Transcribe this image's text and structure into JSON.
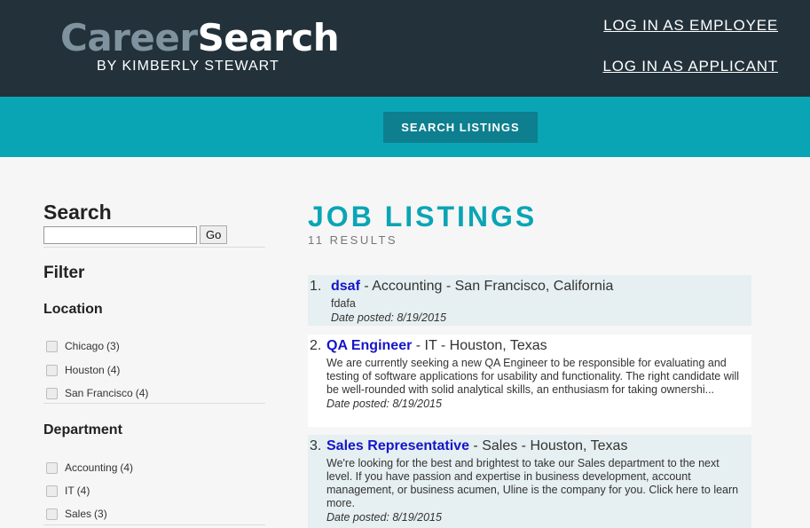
{
  "header": {
    "logo_part1": "Career",
    "logo_part2": "Search",
    "byline": "BY KIMBERLY STEWART",
    "link_employee": "LOG IN AS EMPLOYEE",
    "link_applicant": "LOG IN AS APPLICANT"
  },
  "nav": {
    "search_listings": "SEARCH LISTINGS"
  },
  "sidebar": {
    "search_heading": "Search",
    "search_value": "",
    "go_label": "Go",
    "filter_heading": "Filter",
    "location_heading": "Location",
    "locations": [
      {
        "label": "Chicago",
        "count": "(3)"
      },
      {
        "label": "Houston",
        "count": "(4)"
      },
      {
        "label": "San Francisco",
        "count": "(4)"
      }
    ],
    "department_heading": "Department",
    "departments": [
      {
        "label": "Accounting",
        "count": "(4)"
      },
      {
        "label": "IT",
        "count": "(4)"
      },
      {
        "label": "Sales",
        "count": "(3)"
      }
    ]
  },
  "main": {
    "title": "JOB LISTINGS",
    "results": "11 RESULTS",
    "listings": [
      {
        "num": "1.",
        "title": "dsaf",
        "meta": " - Accounting - San Francisco, California",
        "description": "fdafa",
        "date": "Date posted: 8/19/2015"
      },
      {
        "num": "2.",
        "title": "QA Engineer",
        "meta": " - IT - Houston, Texas",
        "description": "We are currently seeking a new QA Engineer to be responsible for evaluating and testing of software applications for usability and functionality. The right candidate will be well-rounded with solid analytical skills, an enthusiasm for taking ownershi...",
        "date": "Date posted: 8/19/2015"
      },
      {
        "num": "3.",
        "title": "Sales Representative",
        "meta": " - Sales - Houston, Texas",
        "description": "We're looking for the best and brightest to take our Sales department to the next level. If you have passion and expertise in business development, account management, or business acumen, Uline is the company for you. Click here to learn more.",
        "date": "Date posted: 8/19/2015"
      }
    ]
  }
}
